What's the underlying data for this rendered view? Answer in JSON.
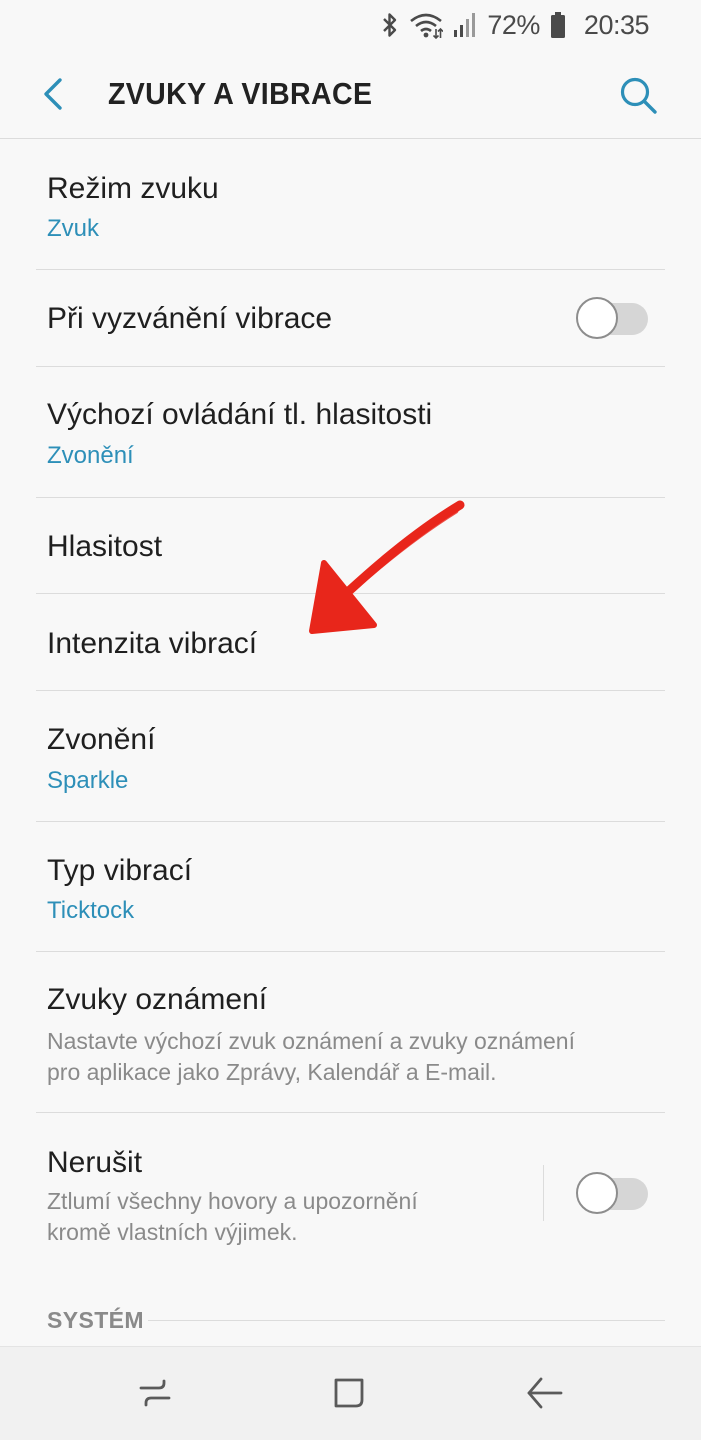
{
  "status_bar": {
    "icons": [
      "bluetooth-icon",
      "wifi-icon",
      "signal-icon",
      "battery-icon"
    ],
    "battery_percent": "72%",
    "time": "20:35"
  },
  "header": {
    "title": "ZVUKY A VIBRACE",
    "back_icon": "chevron-left-icon",
    "search_icon": "search-icon"
  },
  "items": [
    {
      "title": "Režim zvuku",
      "subtitle": "Zvuk"
    },
    {
      "title": "Při vyzvánění vibrace",
      "toggle": false
    },
    {
      "title": "Výchozí ovládání tl. hlasitosti",
      "subtitle": "Zvonění"
    },
    {
      "title": "Hlasitost"
    },
    {
      "title": "Intenzita vibrací"
    },
    {
      "title": "Zvonění",
      "subtitle": "Sparkle"
    },
    {
      "title": "Typ vibrací",
      "subtitle": "Ticktock"
    },
    {
      "title": "Zvuky oznámení",
      "description_lines": [
        "Nastavte výchozí zvuk oznámení a zvuky oznámení",
        "pro aplikace jako Zprávy, Kalendář a E-mail."
      ]
    },
    {
      "title": "Nerušit",
      "description_lines": [
        "Ztlumí všechny hovory a upozornění",
        "kromě vlastních výjimek."
      ],
      "toggle": false
    }
  ],
  "section": {
    "label": "SYSTÉM"
  },
  "nav_bar": {
    "icons": [
      "recents-icon",
      "home-icon",
      "back-icon"
    ]
  },
  "colors": {
    "accent": "#2d8fb8",
    "annotation": "#e8261b",
    "background": "#f8f8f8",
    "divider": "#dcdcdc"
  },
  "annotation": {
    "icon": "red-arrow-icon"
  }
}
